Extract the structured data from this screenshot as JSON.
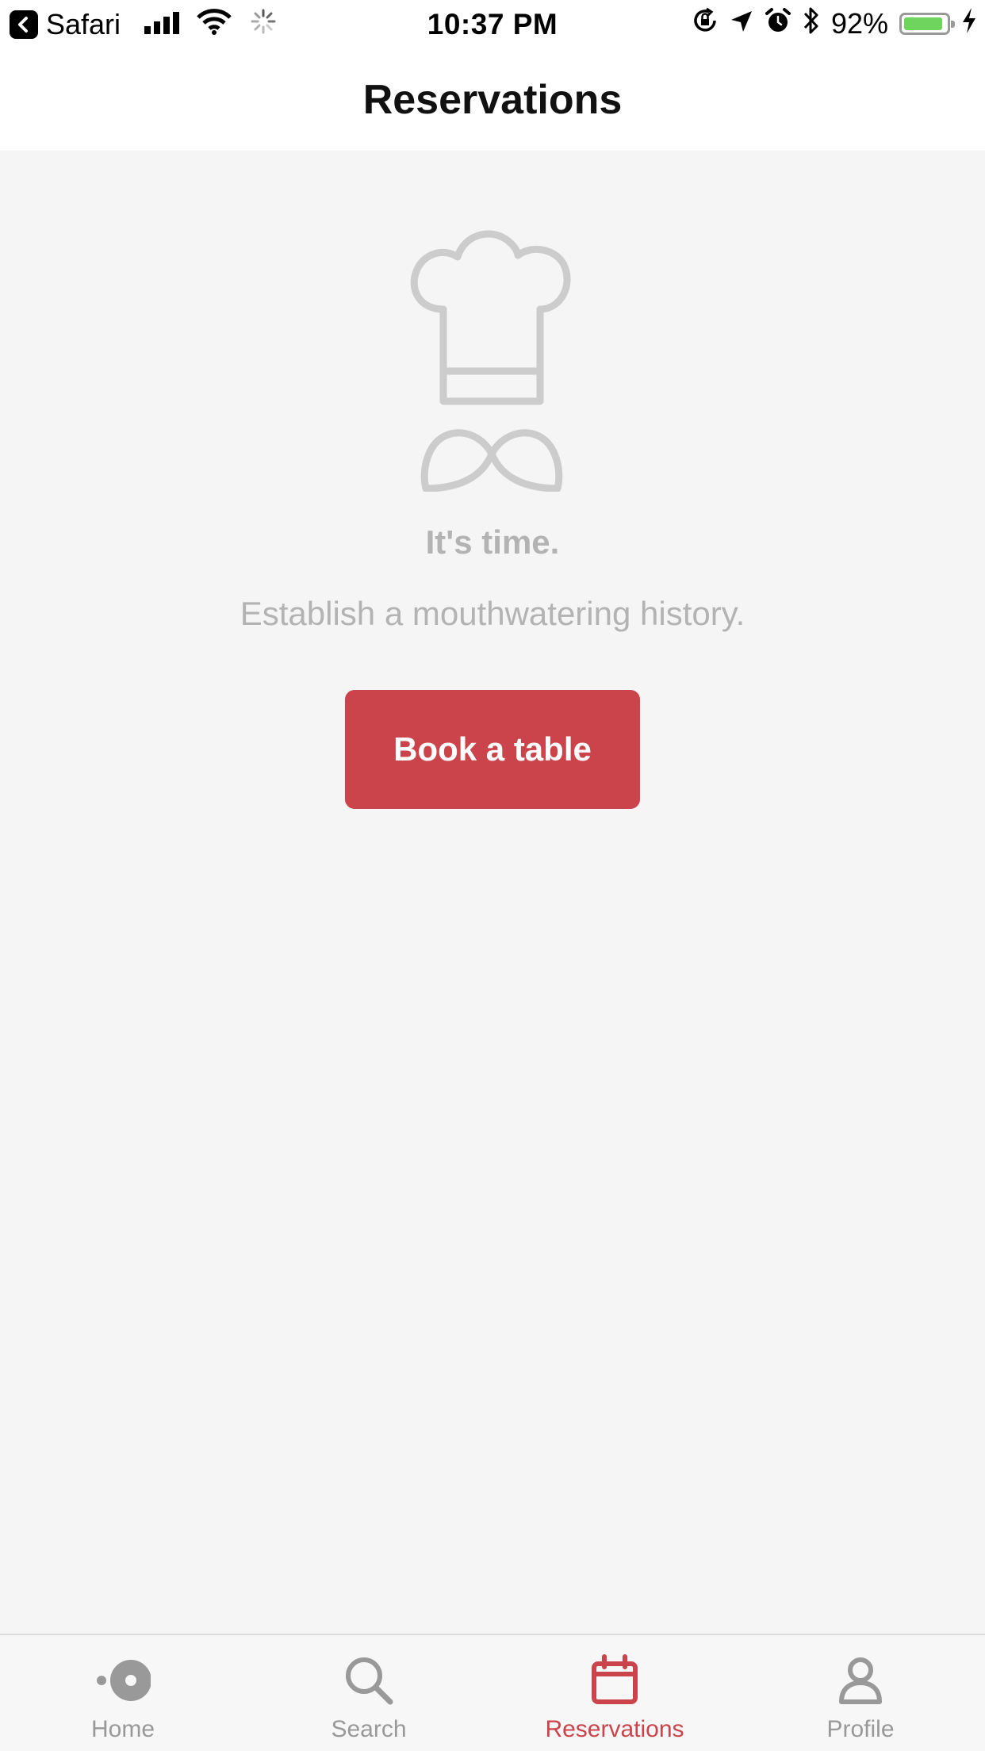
{
  "status_bar": {
    "back_app": "Safari",
    "time": "10:37 PM",
    "battery_percent": "92%",
    "battery_level": 0.92,
    "battery_color": "#6fd45d"
  },
  "header": {
    "title": "Reservations"
  },
  "empty_state": {
    "icon": "chef-hat-icon",
    "headline": "It's time.",
    "message": "Establish a mouthwatering history.",
    "button_label": "Book a table"
  },
  "tabs": [
    {
      "label": "Home",
      "icon": "home-icon",
      "active": false
    },
    {
      "label": "Search",
      "icon": "search-icon",
      "active": false
    },
    {
      "label": "Reservations",
      "icon": "calendar-icon",
      "active": true
    },
    {
      "label": "Profile",
      "icon": "profile-icon",
      "active": false
    }
  ],
  "colors": {
    "accent": "#cc444b",
    "inactive": "#999999",
    "muted_text": "#b3b3b3",
    "icon_gray": "#cccccc"
  }
}
